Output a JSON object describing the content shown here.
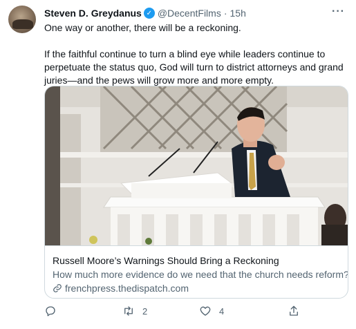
{
  "tweet": {
    "author_name": "Steven D. Greydanus",
    "verified_icon": "verified-badge-icon",
    "handle": "@DecentFilms",
    "separator": "·",
    "time": "15h",
    "more_icon": "more-horizontal-icon",
    "paragraphs": [
      "One way or another, there will be a reckoning.",
      "If the faithful continue to turn a blind eye while leaders continue to perpetuate the status quo, God will turn to district attorneys and grand juries—and the pews will grow more and more empty."
    ]
  },
  "card": {
    "title": "Russell Moore’s Warnings Should Bring a Reckoning",
    "description": "How much more evidence do we need that the church needs reform?",
    "domain": "frenchpress.thedispatch.com",
    "link_icon": "link-icon"
  },
  "actions": {
    "reply": {
      "icon": "reply-icon",
      "count": ""
    },
    "retweet": {
      "icon": "retweet-icon",
      "count": "2"
    },
    "like": {
      "icon": "heart-icon",
      "count": "4"
    },
    "share": {
      "icon": "share-icon",
      "count": ""
    }
  },
  "colors": {
    "accent": "#1d9bf0",
    "text_primary": "#0f1419",
    "text_secondary": "#536471",
    "border": "#cfd9de"
  }
}
